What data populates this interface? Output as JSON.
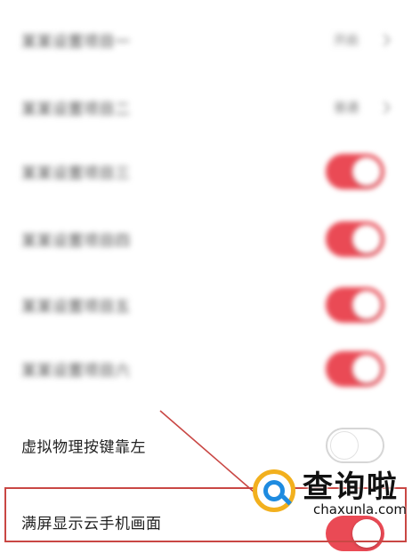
{
  "settings": {
    "rows": [
      {
        "label": "某某设置项目一",
        "value": "开启",
        "type": "select",
        "blurred": true
      },
      {
        "label": "某某设置项目二",
        "value": "普通",
        "type": "select",
        "blurred": true
      },
      {
        "label": "某某设置项目三",
        "type": "toggle",
        "state": "on",
        "blurred": true
      },
      {
        "label": "某某设置项目四",
        "type": "toggle",
        "state": "on",
        "blurred": true
      },
      {
        "label": "某某设置项目五",
        "type": "toggle",
        "state": "on",
        "blurred": true
      },
      {
        "label": "某某设置项目六",
        "type": "toggle",
        "state": "on",
        "blurred": true
      },
      {
        "label": "虚拟物理按键靠左",
        "type": "toggle",
        "state": "off",
        "blurred": false
      },
      {
        "label": "满屏显示云手机画面",
        "type": "toggle",
        "state": "on",
        "blurred": false
      }
    ]
  },
  "watermark": {
    "brand": "查询啦",
    "url": "chaxunla.com"
  },
  "colors": {
    "toggle_on": "#ea4a55",
    "highlight_border": "#c94744",
    "watermark_ring": "#f2b01e",
    "watermark_lens": "#1e8be0"
  }
}
